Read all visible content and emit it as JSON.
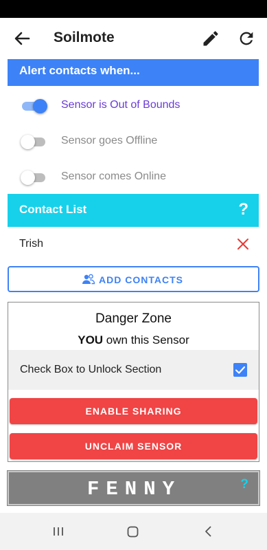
{
  "app_bar": {
    "title": "Soilmote",
    "back_icon": "arrow-left-icon",
    "edit_icon": "pencil-icon",
    "refresh_icon": "refresh-icon"
  },
  "alerts": {
    "header": "Alert contacts when...",
    "toggles": [
      {
        "label": "Sensor is Out of Bounds",
        "on": true
      },
      {
        "label": "Sensor goes Offline",
        "on": false
      },
      {
        "label": "Sensor comes Online",
        "on": false
      }
    ]
  },
  "contacts": {
    "header": "Contact List",
    "help": "?",
    "items": [
      {
        "name": "Trish"
      }
    ],
    "add_label": "ADD CONTACTS"
  },
  "danger_zone": {
    "title": "Danger Zone",
    "owner_emphasis": "YOU",
    "owner_rest": " own this Sensor",
    "unlock_label": "Check Box to Unlock Section",
    "unlock_checked": true,
    "enable_sharing": "ENABLE SHARING",
    "unclaim": "UNCLAIM SENSOR"
  },
  "fenny": {
    "word": "FENNY",
    "help": "?"
  },
  "colors": {
    "primary_blue": "#3d82f7",
    "cyan": "#17d1ea",
    "danger_red": "#f04445",
    "active_label_purple": "#6a3bd6"
  }
}
